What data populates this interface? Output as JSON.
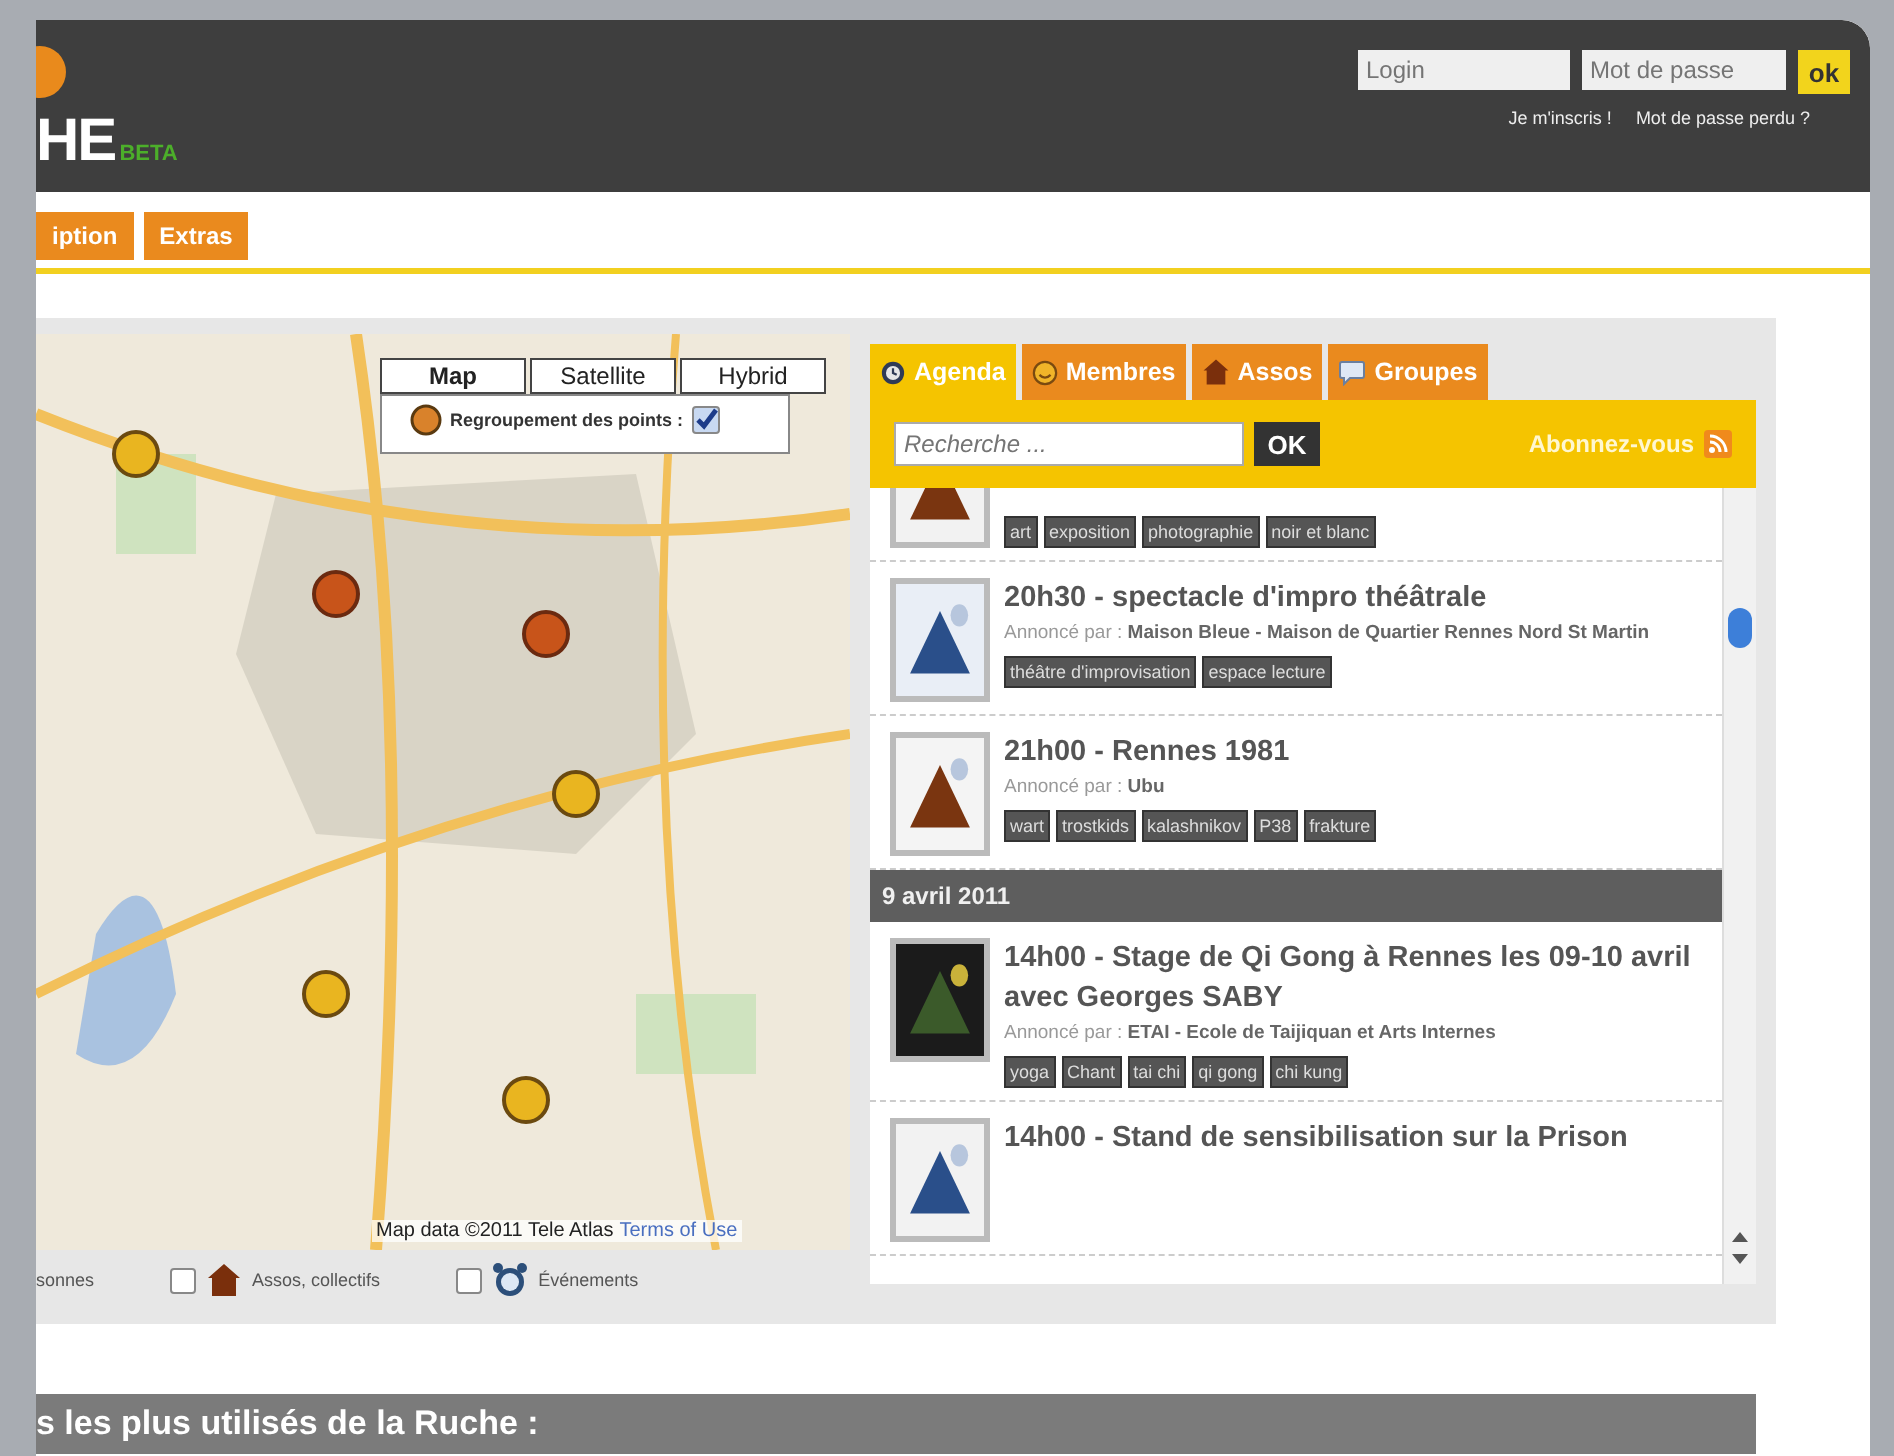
{
  "header": {
    "logo_text": "HE",
    "logo_badge": "BETA",
    "login": {
      "placeholder": "Login"
    },
    "password": {
      "placeholder": "Mot de passe"
    },
    "submit": "ok",
    "links": [
      "Je m'inscris !",
      "Mot de passe perdu ?"
    ]
  },
  "nav": [
    {
      "label": "iption"
    },
    {
      "label": "Extras"
    }
  ],
  "map": {
    "kind": "picture",
    "types": [
      {
        "label": "Map",
        "selected": true
      },
      {
        "label": "Satellite",
        "selected": false
      },
      {
        "label": "Hybrid",
        "selected": false
      }
    ],
    "clustering": {
      "label": "Regroupement des points :",
      "checked": true
    },
    "attribution": "Map data ©2011 Tele Atlas",
    "terms": "Terms of Use",
    "legend": [
      {
        "kind": "plain",
        "label": "sonnes"
      },
      {
        "kind": "house",
        "label": "Assos, collectifs",
        "checked": false
      },
      {
        "kind": "clock",
        "label": "Événements",
        "checked": false
      }
    ]
  },
  "panel": {
    "tabs": [
      {
        "label": "Agenda",
        "selected": true
      },
      {
        "label": "Membres",
        "selected": false
      },
      {
        "label": "Assos",
        "selected": false
      },
      {
        "label": "Groupes",
        "selected": false
      }
    ],
    "search": {
      "placeholder": "Recherche ...",
      "button": "OK"
    },
    "subscribe": "Abonnez-vous",
    "list": [
      {
        "kind": "event",
        "tags": [
          "art",
          "exposition",
          "photographie",
          "noir et blanc"
        ]
      },
      {
        "kind": "event",
        "title": "20h30 - spectacle d'impro théâtrale",
        "by": "Annoncé par : **Maison Bleue - Maison de Quartier Rennes Nord St Martin**",
        "tags": [
          "théâtre d'improvisation",
          "espace lecture"
        ]
      },
      {
        "kind": "event",
        "title": "21h00 - Rennes 1981",
        "by": "Annoncé par : **Ubu**",
        "tags": [
          "wart",
          "trostkids",
          "kalashnikov",
          "P38",
          "frakture"
        ]
      },
      {
        "kind": "date",
        "label": "9 avril 2011"
      },
      {
        "kind": "event",
        "title": "14h00 - Stage de Qi Gong à Rennes les 09-10 avril avec Georges SABY",
        "by": "Annoncé par : **ETAI - Ecole de Taijiquan et Arts Internes**",
        "tags": [
          "yoga",
          "Chant",
          "tai chi",
          "qi gong",
          "chi kung"
        ]
      },
      {
        "kind": "event",
        "title": "14h00 - Stand de sensibilisation sur la Prison"
      }
    ]
  },
  "bottom_bar": {
    "title": "s les plus utilisés de la Ruche :"
  }
}
